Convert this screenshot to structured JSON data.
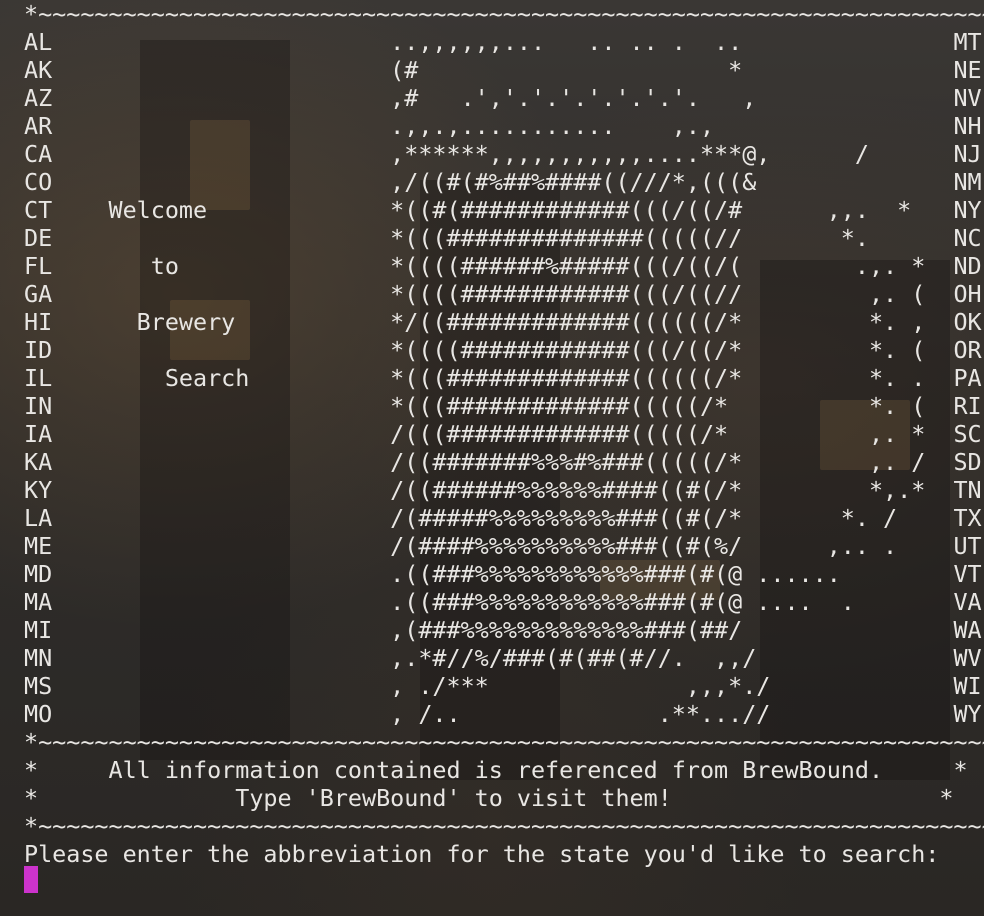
{
  "border_line": "*~~~~~~~~~~~~~~~~~~~~~~~~~~~~~~~~~~~~~~~~~~~~~~~~~~~~~~~~~~~~~~~~~~~~~~*",
  "left_states": [
    "AL",
    "AK",
    "AZ",
    "AR",
    "CA",
    "CO",
    "CT",
    "DE",
    "FL",
    "GA",
    "HI",
    "ID",
    "IL",
    "IN",
    "IA",
    "KA",
    "KY",
    "LA",
    "ME",
    "MD",
    "MA",
    "MI",
    "MN",
    "MS",
    "MO"
  ],
  "right_states": [
    "MT",
    "NE",
    "NV",
    "NH",
    "NJ",
    "NM",
    "NY",
    "NC",
    "ND",
    "OH",
    "OK",
    "OR",
    "PA",
    "RI",
    "SC",
    "SD",
    "TN",
    "TX",
    "UT",
    "VT",
    "VA",
    "WA",
    "WV",
    "WI",
    "WY"
  ],
  "welcome_words": [
    "",
    "",
    "",
    "",
    "",
    "",
    "Welcome",
    "",
    "to",
    "",
    "Brewery",
    "",
    "Search",
    "",
    "",
    "",
    "",
    "",
    "",
    "",
    "",
    "",
    "",
    "",
    ""
  ],
  "ascii_art": [
    "..,,,,,,...   .. .. .  ..",
    "(#                      *",
    ",#   .','.'.'.'.'.'.'.   ,",
    ".,,.,...........    ,.,",
    ",******,,,,,,,,,,,....***@,      /",
    ",/((#(#%##%####((///*,(((&",
    "*((#(############(((/((/#      ,,.  *",
    "*(((##############(((((//       *.",
    "*((((######%#####(((/((/(        .,. *",
    "*((((############(((/((//         ,. (",
    "*/((#############((((((/*         *. ,",
    "*((((############(((/((/*         *. (",
    "*(((#############((((((/*         *. .",
    "*(((#############(((((/*          *. (",
    "/(((#############(((((/*          ,. *",
    "/((#######%%%#%###(((((/*         ,. /",
    "/((######%%%%%%####((#(/*         *,.*",
    "/(#####%%%%%%%%%###((#(/*       *. /",
    "/(####%%%%%%%%%%###((#(%/      ,.. .",
    ".((###%%%%%%%%%%%%###(#(@ ......",
    ".((###%%%%%%%%%%%%###(#(@ ....  .",
    ",(###%%%%%%%%%%%%%###(##/",
    ",.*#//%/###(#(##(#//.  ,,/",
    ", ./***              ,,,*./",
    ", /..              .**...//"
  ],
  "info_line_1": "All information contained is referenced from BrewBound.",
  "info_line_2": "Type 'BrewBound' to visit them!",
  "prompt": "Please enter the abbreviation for the state you'd like to search:"
}
